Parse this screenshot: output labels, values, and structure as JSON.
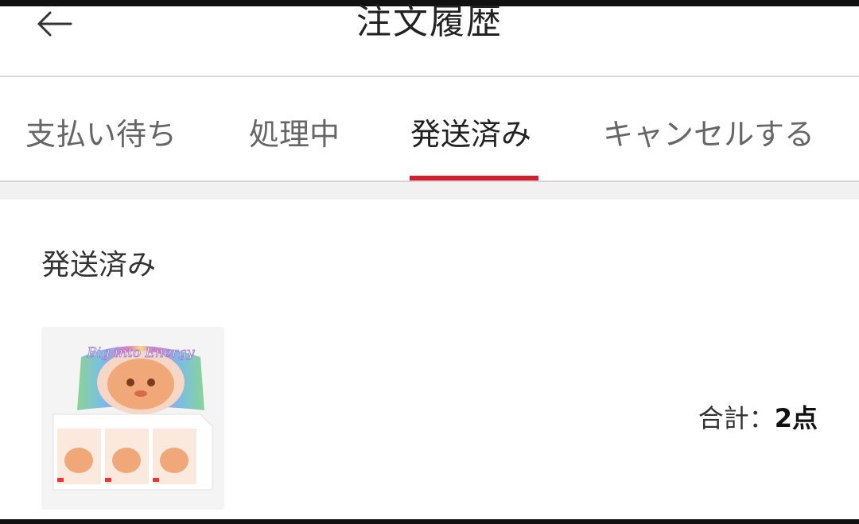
{
  "header": {
    "title": "注文履歴",
    "back_icon": "arrow-left-icon"
  },
  "tabs": [
    {
      "label": "支払い待ち",
      "active": false
    },
    {
      "label": "処理中",
      "active": false
    },
    {
      "label": "発送済み",
      "active": true
    },
    {
      "label": "キャンセルする",
      "active": false
    }
  ],
  "colors": {
    "accent": "#d81e2c",
    "text_primary": "#222222",
    "text_secondary": "#666666",
    "divider": "#d8d8d8",
    "section_gap": "#f1f1f1"
  },
  "order": {
    "status": "発送済み",
    "product_image_text": "Big into Energy",
    "total_label": "合計：",
    "total_count": "2点"
  }
}
